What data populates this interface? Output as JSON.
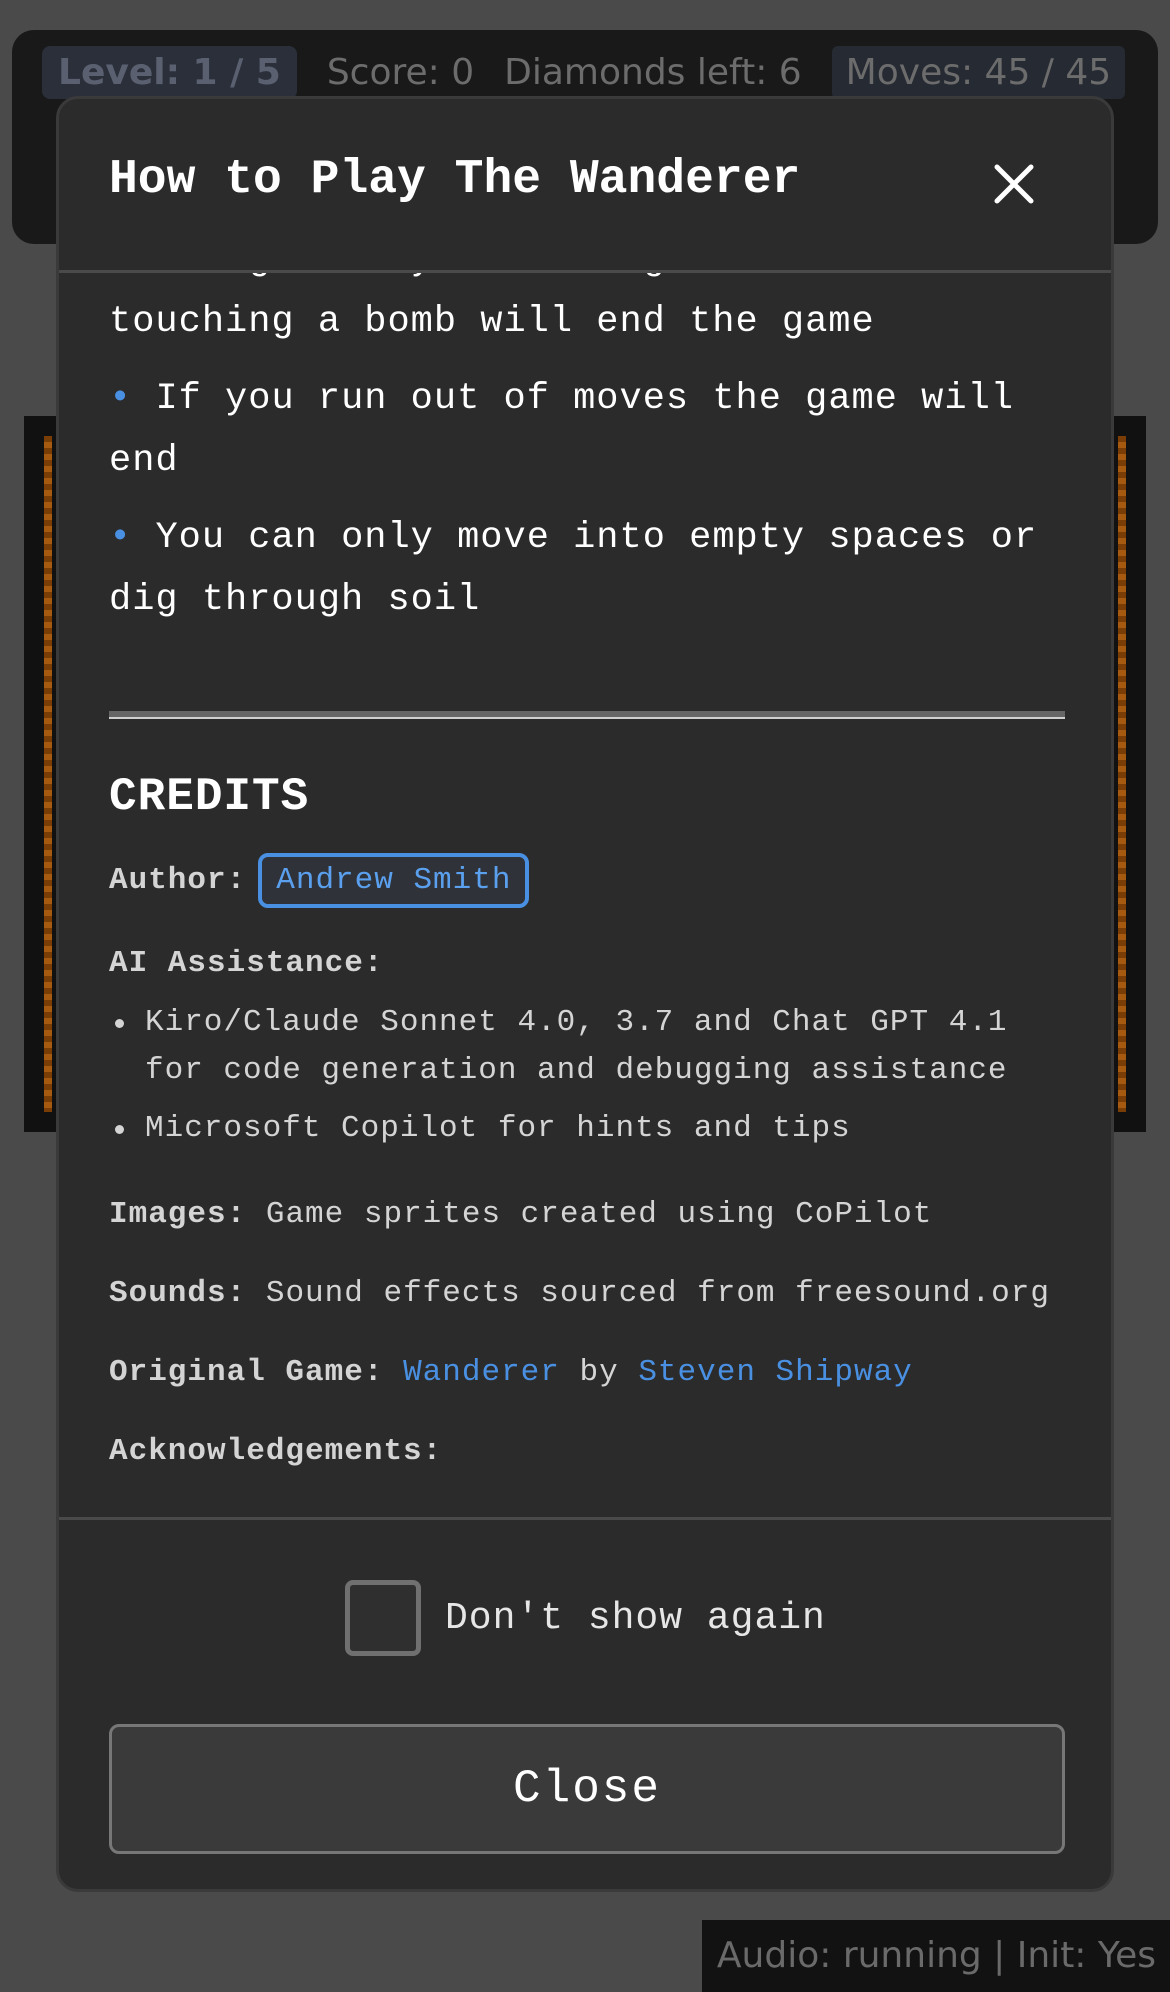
{
  "hud": {
    "level": "Level: 1 / 5",
    "score": "Score: 0",
    "diamonds": "Diamonds left: 6",
    "moves": "Moves: 45 / 45"
  },
  "modal": {
    "title": "How to Play The Wanderer",
    "close_icon": "close-icon",
    "rules": [
      "Being hit by a falling boulder or touching a bomb will end the game",
      "If you run out of moves the game will end",
      "You can only move into empty spaces or dig through soil"
    ],
    "bullet": "•",
    "credits": {
      "title": "CREDITS",
      "author_label": "Author:",
      "author_name": "Andrew Smith",
      "ai_label": "AI Assistance:",
      "ai_items": [
        "Kiro/Claude Sonnet 4.0, 3.7 and Chat GPT 4.1 for code generation and debugging assistance",
        "Microsoft Copilot for hints and tips"
      ],
      "images_label": "Images:",
      "images_text": "Game sprites created using CoPilot",
      "sounds_label": "Sounds:",
      "sounds_text": "Sound effects sourced from freesound.org",
      "original_label": "Original Game:",
      "original_game": "Wanderer",
      "original_by": "by",
      "original_author": "Steven Shipway",
      "ack_label": "Acknowledgements:"
    },
    "dont_show_label": "Don't show again",
    "dont_show_checked": false,
    "close_button": "Close"
  },
  "status_bar": "Audio: running | Init: Yes",
  "colors": {
    "accent": "#4a90e2",
    "modal_bg": "#2b2b2b",
    "page_bg": "#4a4a4a"
  }
}
